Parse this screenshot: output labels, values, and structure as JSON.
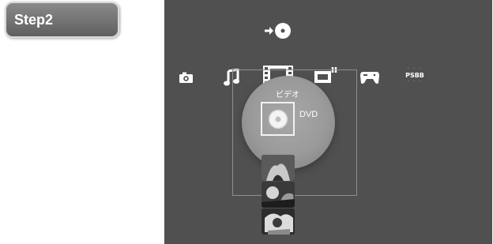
{
  "step_label": "Step2",
  "top_icon": "disc-play-icon",
  "xmb_categories": [
    {
      "name": "photo",
      "icon": "camera-icon"
    },
    {
      "name": "music",
      "icon": "music-note-icon"
    },
    {
      "name": "video",
      "icon": "film-icon",
      "selected": true
    },
    {
      "name": "tv",
      "icon": "tv-icon"
    },
    {
      "name": "game",
      "icon": "gamepad-icon"
    },
    {
      "name": "network",
      "icon": "psbb-icon",
      "text": "PSBB"
    }
  ],
  "selected_category_label": "ビデオ",
  "selected_item_label": "DVD",
  "selected_item_icon": "dvd-disc-icon",
  "colors": {
    "screen_bg": "#505050",
    "badge_bg": "#6e6e6e",
    "text": "#ffffff"
  }
}
